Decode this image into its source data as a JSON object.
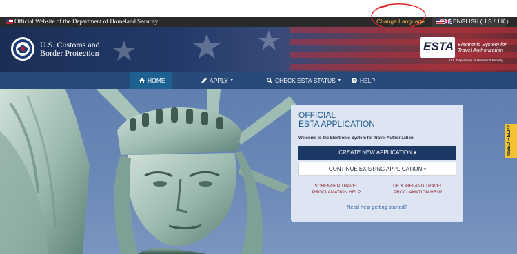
{
  "gov_bar": {
    "official_text": "Official Website of the Department of Homeland Security",
    "change_language": "Change Language",
    "language": "ENGLISH (U.S./U.K.)"
  },
  "header": {
    "agency_line1": "U.S. Customs and",
    "agency_line2": "Border Protection",
    "esta_logo": "ESTA",
    "esta_desc_line1": "Electronic System for",
    "esta_desc_line2": "Travel Authorization",
    "esta_dept": "U.S. Department of Homeland Security"
  },
  "nav": {
    "items": [
      {
        "label": "HOME",
        "icon": "home-icon"
      },
      {
        "label": "APPLY",
        "icon": "pencil-icon"
      },
      {
        "label": "CHECK ESTA STATUS",
        "icon": "search-icon"
      },
      {
        "label": "HELP",
        "icon": "question-icon"
      }
    ]
  },
  "card": {
    "title_line1": "OFFICIAL",
    "title_line2": "ESTA APPLICATION",
    "welcome": "Welcome to the Electronic System for Travel Authorization",
    "create_button": "CREATE NEW APPLICATION",
    "continue_button": "CONTINUE EXISTING APPLICATION",
    "schengen_line1": "SCHENGEN TRAVEL",
    "schengen_line2": "PROCLAMATION HELP",
    "uk_line1": "UK & IRELAND TRAVEL",
    "uk_line2": "PROCLAMATION HELP",
    "help_link": "Need help getting started?"
  },
  "side_tab": {
    "label": "NEED HELP?"
  },
  "colors": {
    "nav_bg": "#274a78",
    "nav_active": "#1d6190",
    "create_button": "#1d3864",
    "link_red": "#8b2230",
    "annotation": "#e0262a",
    "change_language": "#f0b44a",
    "side_tab": "#f2c230"
  }
}
